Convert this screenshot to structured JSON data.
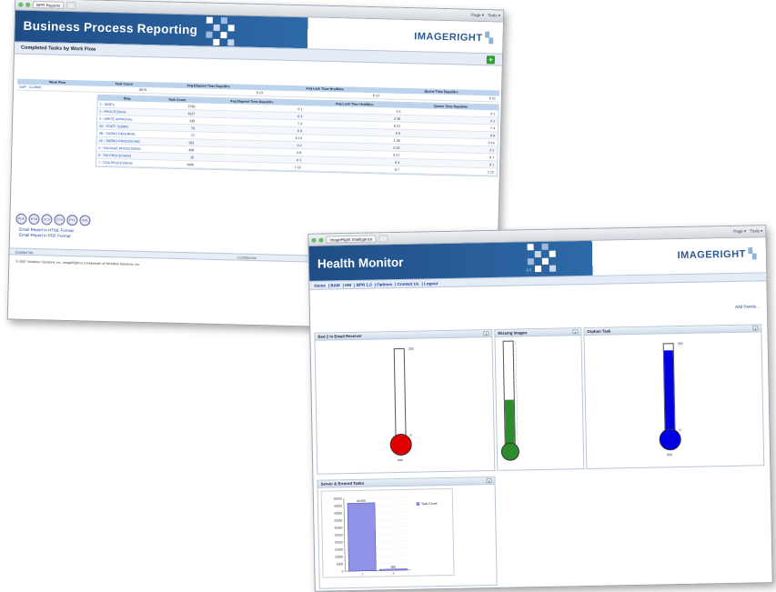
{
  "win1": {
    "chrome": {
      "tab": "BPR Reports",
      "tools": [
        "Page ▾",
        "Tools ▾"
      ]
    },
    "banner_title": "Business Process Reporting",
    "logo": "IMAGERIGHT",
    "subtitle": "Completed Tasks by Work Flow",
    "workflow_table": {
      "headers": [
        "Work Flow",
        "Task Count",
        "Avg Elapsed Time Days/Hrs",
        "Avg Lock Time Hrs/Mins",
        "Queue Time Days/Hrs"
      ],
      "row": [
        "GUP - CLAIMS",
        "6675",
        "0  13",
        "0  13",
        "0  21"
      ]
    },
    "steps_table": {
      "headers": [
        "Step",
        "Task Count",
        "Avg Elapsed Time Days/Hrs",
        "Avg Lock Time Hrs/Mins",
        "Queue Time Days/Hrs"
      ],
      "rows": [
        [
          "1 - INDEX",
          "2790",
          "0  1",
          "0  4",
          "0  1"
        ],
        [
          "2 - PROCESSING",
          "3227",
          "0  3",
          "0  36",
          "0  1"
        ],
        [
          "3 - WRITE APPROVAL",
          "335",
          "7  4",
          "0  21",
          "7  4"
        ],
        [
          "3A - STAFF SUBRO",
          "76",
          "0  6",
          "0  6",
          "0  6"
        ],
        [
          "3B - SUBRO DEFERRAL",
          "77",
          "0  13",
          "1  48",
          "0  14"
        ],
        [
          "4C - SUBRO PROCESSING",
          "361",
          "0  2",
          "0  32",
          "0  1"
        ],
        [
          "5 - SALVAGE PROCESSING",
          "498",
          "0  8",
          "0  27",
          "0  7"
        ],
        [
          "6 - SIU PROCESSING",
          "15",
          "0  1",
          "0  4",
          "0  1"
        ],
        [
          "7 - DOA PROCESSING",
          "1645",
          "1  12",
          "0  7",
          "1  12"
        ]
      ]
    },
    "exports": [
      "PDF",
      "HTM",
      "XLS",
      "CSV",
      "RTF",
      "XML"
    ],
    "email_links": [
      "Email Report in HTML Format",
      "Email Report in PDF Format"
    ],
    "footer_left": "Contact Us",
    "footer_center": "Confidential",
    "copyright": "© 2007 Vertafore Solutions, Inc. ImageRight is a trademark of Vertafore Solutions, Inc."
  },
  "win2": {
    "chrome": {
      "tab": "ImageRight Intelligence",
      "tools": [
        "Page ▾",
        "Tools ▾"
      ]
    },
    "banner_title": "Health Monitor",
    "version": "1.0",
    "logo": "IMAGERIGHT",
    "nav": [
      "Home",
      "BAM",
      "HM",
      "BPR 1.0",
      "Options",
      "Contact Us",
      "Logout"
    ],
    "add_panels": "Add Panels...",
    "panels": {
      "email_receiver": {
        "title": "Bed 2 in Email Receiver",
        "max": "200",
        "value": "0",
        "label": "last",
        "level_pct": 0
      },
      "missing_images": {
        "title": "Missing Images",
        "level_pct": 45
      },
      "orphan_task": {
        "title": "Orphan Task",
        "max": "200",
        "value": "0",
        "label": "999",
        "level_pct": 93
      },
      "server_errored": {
        "title": "Server & Errored Tasks"
      }
    },
    "chart_data": {
      "type": "bar",
      "categories": [
        "1",
        "2"
      ],
      "series": [
        {
          "name": "Task Count",
          "values": [
            46659,
            850
          ]
        }
      ],
      "ylim": [
        0,
        50000
      ],
      "yticks": [
        "50000",
        "45000",
        "40000",
        "35000",
        "30000",
        "25000",
        "20000",
        "15000",
        "10000",
        "5000",
        "0"
      ],
      "data_labels": [
        "46,659",
        "850"
      ],
      "legend_position": "top-right"
    },
    "colors": {
      "banner": "#1f4d86",
      "red": "#e00000",
      "green": "#2e8b2e",
      "blue": "#0000e0"
    }
  }
}
